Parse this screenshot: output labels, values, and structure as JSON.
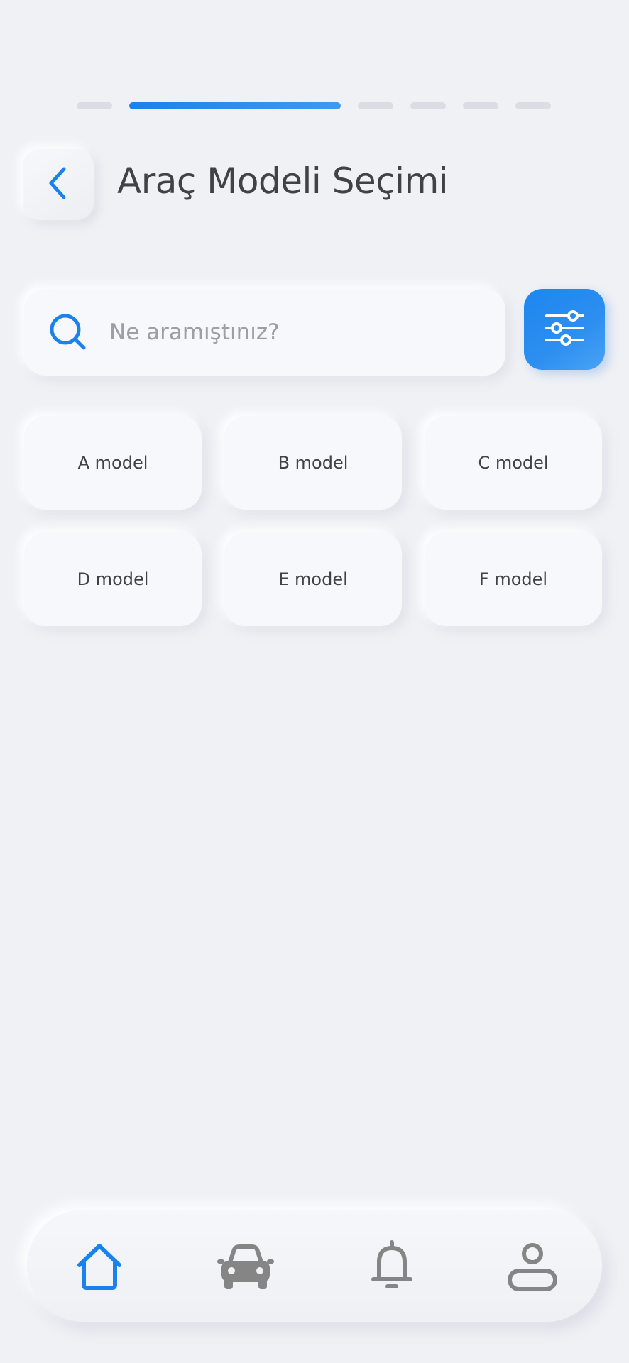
{
  "progress": {
    "total_steps": 6,
    "current_step": 2
  },
  "header": {
    "title": "Araç Modeli Seçimi",
    "back_icon": "chevron-left-icon"
  },
  "search": {
    "placeholder": "Ne aramıştınız?",
    "value": "",
    "icon": "search-icon"
  },
  "filter": {
    "icon": "sliders-icon"
  },
  "models": [
    {
      "label": "A model"
    },
    {
      "label": "B model"
    },
    {
      "label": "C model"
    },
    {
      "label": "D model"
    },
    {
      "label": "E model"
    },
    {
      "label": "F model"
    }
  ],
  "bottom_nav": {
    "items": [
      {
        "icon": "home-icon",
        "active": true
      },
      {
        "icon": "car-icon",
        "active": false
      },
      {
        "icon": "bell-icon",
        "active": false
      },
      {
        "icon": "user-icon",
        "active": false
      }
    ]
  },
  "colors": {
    "background": "#eff1f5",
    "accent": "#1a82ec",
    "text": "#3f4247",
    "placeholder": "#9c9fa5",
    "inactive_icon": "#858585",
    "inactive_step": "#dadde3"
  }
}
